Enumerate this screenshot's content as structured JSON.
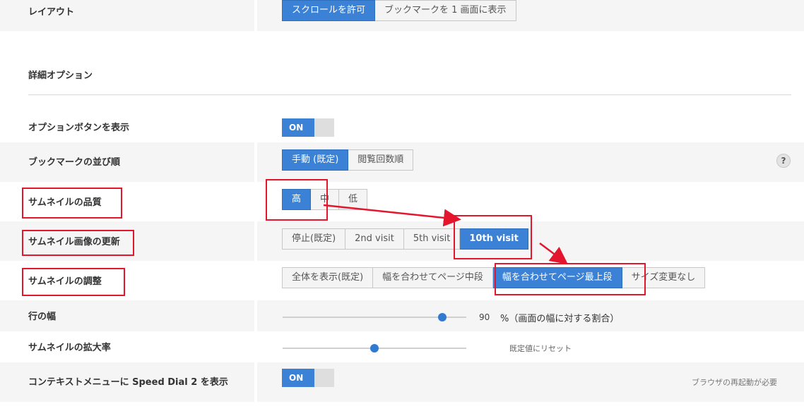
{
  "layout": {
    "label": "レイアウト",
    "options": [
      "スクロールを許可",
      "ブックマークを 1 画面に表示"
    ],
    "selected": 0
  },
  "advanced": {
    "heading": "詳細オプション"
  },
  "show_options_button": {
    "label": "オプションボタンを表示",
    "toggle": "ON"
  },
  "bookmark_order": {
    "label": "ブックマークの並び順",
    "options": [
      "手動 (既定)",
      "閲覧回数順"
    ],
    "selected": 0,
    "help": "?"
  },
  "thumbnail_quality": {
    "label": "サムネイルの品質",
    "options": [
      "高",
      "中",
      "低"
    ],
    "selected": 0
  },
  "thumbnail_update": {
    "label": "サムネイル画像の更新",
    "options": [
      "停止(既定)",
      "2nd visit",
      "5th visit",
      "10th visit"
    ],
    "selected": 3
  },
  "thumbnail_fit": {
    "label": "サムネイルの調整",
    "options": [
      "全体を表示(既定)",
      "幅を合わせてページ中段",
      "幅を合わせてページ最上段",
      "サイズ変更なし"
    ],
    "selected": 2
  },
  "row_width": {
    "label": "行の幅",
    "value": "90",
    "value_fraction": 0.87,
    "unit_text": "%（画面の幅に対する割合）"
  },
  "thumbnail_zoom": {
    "label": "サムネイルの拡大率",
    "value_fraction": 0.5,
    "reset_label": "既定値にリセット"
  },
  "context_menu": {
    "label": "コンテキストメニューに Speed Dial 2 を表示",
    "toggle": "ON",
    "note": "ブラウザの再起動が必要"
  },
  "colors": {
    "accent": "#3b82d6",
    "highlight": "#e3162e",
    "row_shade": "#f5f5f5"
  }
}
